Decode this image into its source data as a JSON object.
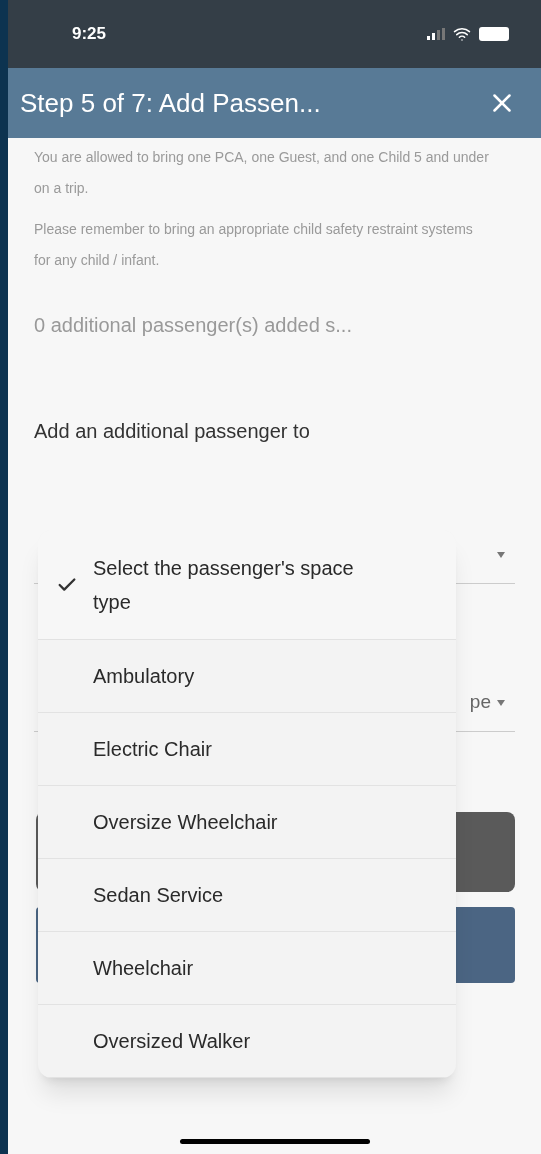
{
  "status_bar": {
    "time": "9:25"
  },
  "header": {
    "title": "Step 5 of 7: Add Passen..."
  },
  "notices": [
    "You are allowed to bring one PCA, one Guest, and one Child 5 and under on a trip.",
    "Please remember to bring an appropriate child safety restraint systems for any child / infant."
  ],
  "summary": "0 additional passenger(s) added s...",
  "section_title": "Add an additional passenger to",
  "form_behind": {
    "partial_value": "pe"
  },
  "menu": {
    "options": [
      {
        "label": "Select the passenger's space type",
        "selected": true
      },
      {
        "label": "Ambulatory",
        "selected": false
      },
      {
        "label": "Electric Chair",
        "selected": false
      },
      {
        "label": "Oversize Wheelchair",
        "selected": false
      },
      {
        "label": "Sedan Service",
        "selected": false
      },
      {
        "label": "Wheelchair",
        "selected": false
      },
      {
        "label": "Oversized Walker",
        "selected": false
      }
    ]
  }
}
